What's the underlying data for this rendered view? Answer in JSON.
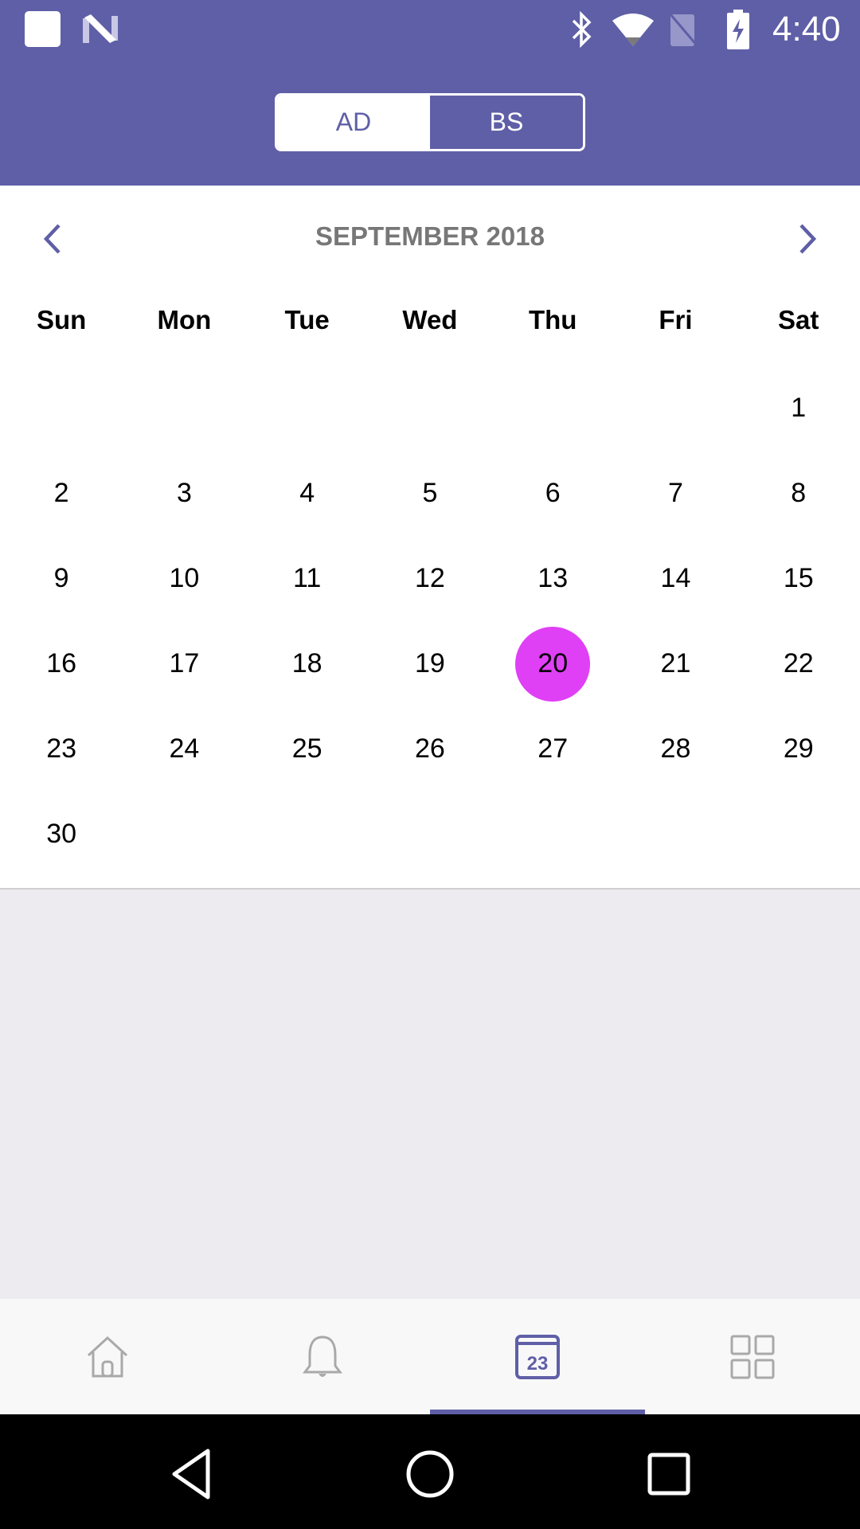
{
  "status_bar": {
    "time": "4:40",
    "left_icons": [
      "notification-square-icon",
      "android-n-icon"
    ],
    "right_icons": [
      "bluetooth-icon",
      "wifi-icon",
      "no-sim-icon",
      "battery-charging-icon"
    ]
  },
  "header": {
    "calendar_toggle": {
      "options": [
        "AD",
        "BS"
      ],
      "selected": "AD"
    }
  },
  "calendar": {
    "month_title": "SEPTEMBER 2018",
    "prev_icon": "chevron-left-icon",
    "next_icon": "chevron-right-icon",
    "weekdays": [
      "Sun",
      "Mon",
      "Tue",
      "Wed",
      "Thu",
      "Fri",
      "Sat"
    ],
    "weeks": [
      [
        "",
        "",
        "",
        "",
        "",
        "",
        "1"
      ],
      [
        "2",
        "3",
        "4",
        "5",
        "6",
        "7",
        "8"
      ],
      [
        "9",
        "10",
        "11",
        "12",
        "13",
        "14",
        "15"
      ],
      [
        "16",
        "17",
        "18",
        "19",
        "20",
        "21",
        "22"
      ],
      [
        "23",
        "24",
        "25",
        "26",
        "27",
        "28",
        "29"
      ],
      [
        "30",
        "",
        "",
        "",
        "",
        "",
        ""
      ]
    ],
    "selected_day": "20",
    "selected_color": "#e040f5"
  },
  "bottom_nav": {
    "items": [
      {
        "icon": "home-icon",
        "active": false
      },
      {
        "icon": "bell-icon",
        "active": false
      },
      {
        "icon": "calendar-icon",
        "badge": "23",
        "active": true
      },
      {
        "icon": "grid-icon",
        "active": false
      }
    ]
  },
  "system_nav": {
    "buttons": [
      "back-icon",
      "home-circle-icon",
      "recents-icon"
    ]
  },
  "colors": {
    "primary": "#5f5fa7",
    "selected": "#e040f5",
    "inactive_icon": "#a9a9a9",
    "month_title": "#777777"
  }
}
